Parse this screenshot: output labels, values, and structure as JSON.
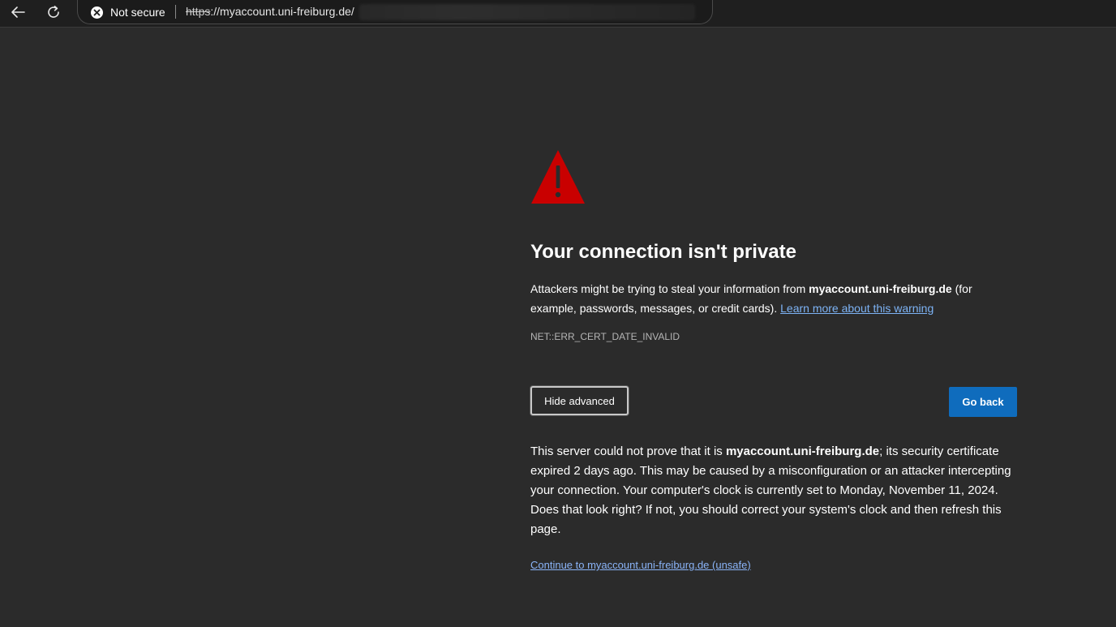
{
  "browser": {
    "security_label": "Not secure",
    "url_scheme": "https",
    "url_rest": "://myaccount.uni-freiburg.de/",
    "back_icon": "arrow-left-icon",
    "reload_icon": "reload-icon"
  },
  "page": {
    "title": "Your connection isn't private",
    "desc_part1": "Attackers might be trying to steal your information from ",
    "desc_host": "myaccount.uni-freiburg.de",
    "desc_part2": " (for example, passwords, messages, or credit cards). ",
    "learn_more": "Learn more about this warning",
    "error_code": "NET::ERR_CERT_DATE_INVALID",
    "hide_advanced": "Hide advanced",
    "go_back": "Go back",
    "details_part1": "This server could not prove that it is ",
    "details_host": "myaccount.uni-freiburg.de",
    "details_part2": "; its security certificate expired 2 days ago. This may be caused by a misconfiguration or an attacker intercepting your connection. Your computer's clock is currently set to Monday, November 11, 2024. Does that look right? If not, you should correct your system's clock and then refresh this page.",
    "proceed_link": "Continue to myaccount.uni-freiburg.de (unsafe)"
  },
  "colors": {
    "background": "#2b2b2b",
    "warning_red": "#c90000",
    "primary_button": "#0f6cbd",
    "link": "#8ab4f8"
  }
}
